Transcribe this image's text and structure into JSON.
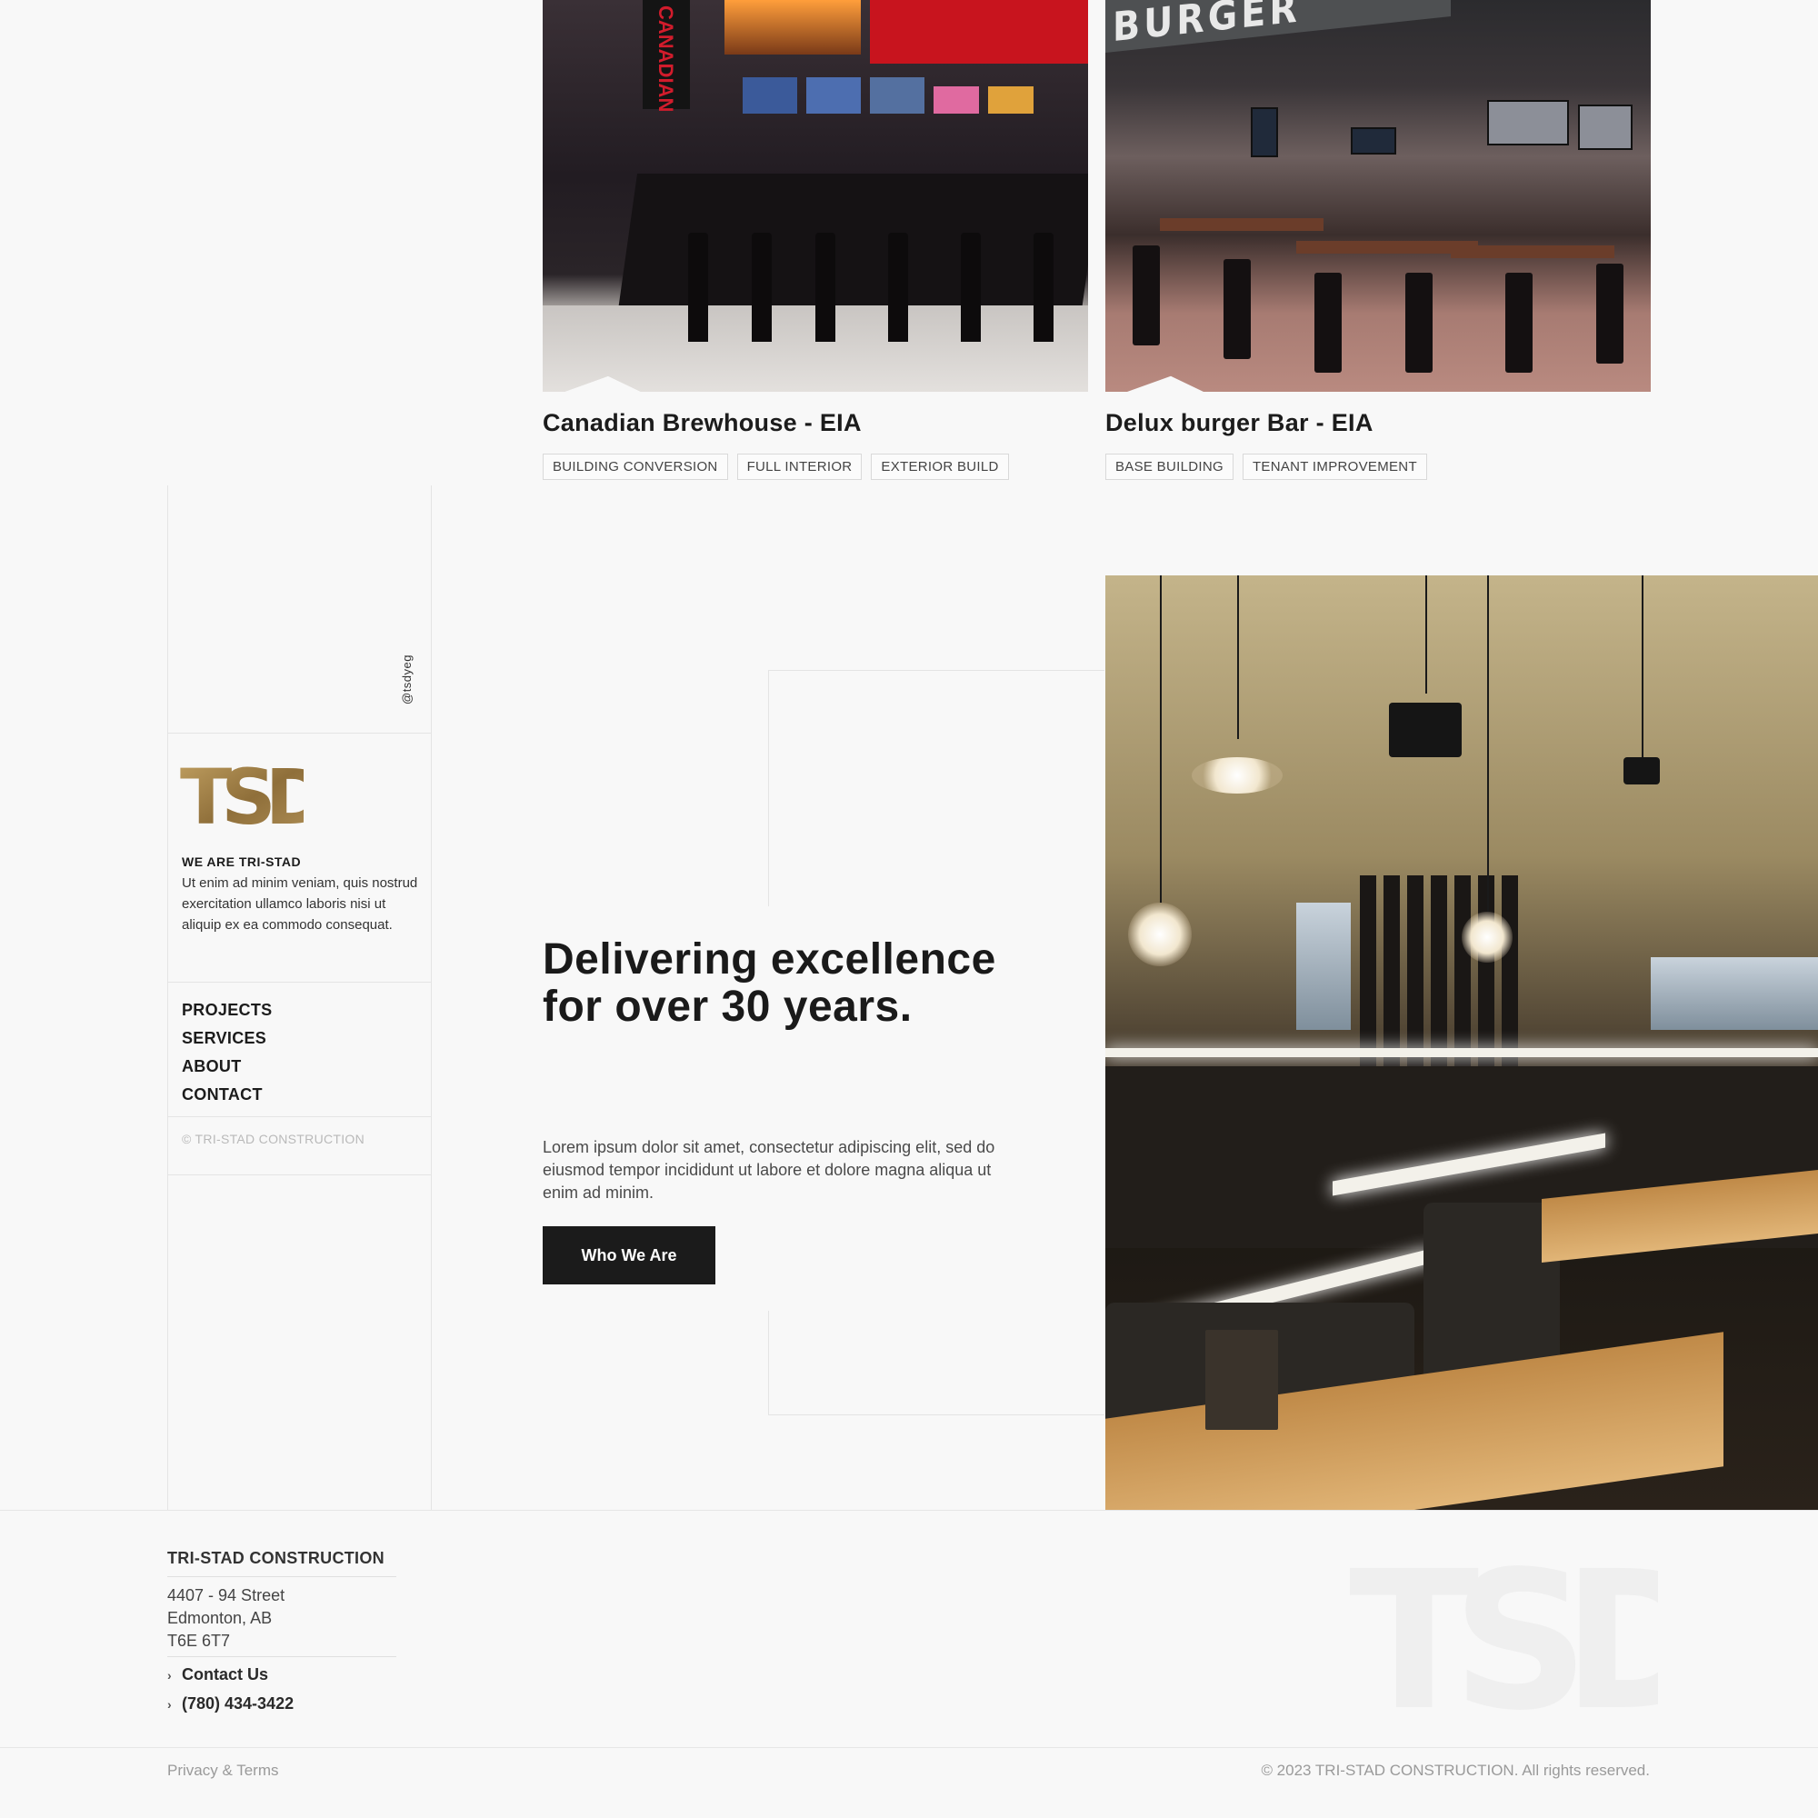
{
  "projects": [
    {
      "title": "Canadian Brewhouse - EIA",
      "sign_text": "CANADIAN",
      "tags": [
        "BUILDING CONVERSION",
        "FULL INTERIOR",
        "EXTERIOR BUILD"
      ]
    },
    {
      "title": "Delux burger Bar - EIA",
      "sign_text": "BURGER",
      "tags": [
        "BASE BUILDING",
        "TENANT IMPROVEMENT"
      ]
    }
  ],
  "sidebar": {
    "handle": "@tsdyeg",
    "logo": "TSD",
    "about_title": "WE ARE TRI-STAD",
    "about_body": "Ut enim ad minim veniam, quis nostrud exercitation ullamco laboris nisi ut aliquip ex ea commodo consequat.",
    "nav": [
      "PROJECTS",
      "SERVICES",
      "ABOUT",
      "CONTACT"
    ],
    "copyright": "© TRI-STAD CONSTRUCTION"
  },
  "hero": {
    "title": "Delivering excellence for over 30 years.",
    "body": "Lorem ipsum dolor sit amet, consectetur adipiscing elit, sed do eiusmod tempor incididunt ut labore et dolore magna aliqua ut enim ad minim.",
    "cta_label": "Who We Are"
  },
  "footer": {
    "company": "TRI-STAD CONSTRUCTION",
    "address": [
      "4407 - 94 Street",
      "Edmonton, AB",
      "T6E 6T7"
    ],
    "links": [
      "Contact Us",
      "(780) 434-3422"
    ],
    "privacy": "Privacy & Terms",
    "rights": "© 2023 TRI-STAD CONSTRUCTION. All rights reserved.",
    "watermark": "TSD"
  },
  "colors": {
    "accent_gold": "#a8874a",
    "cta_bg": "#1b1b1b",
    "page_bg": "#f8f8f8"
  }
}
